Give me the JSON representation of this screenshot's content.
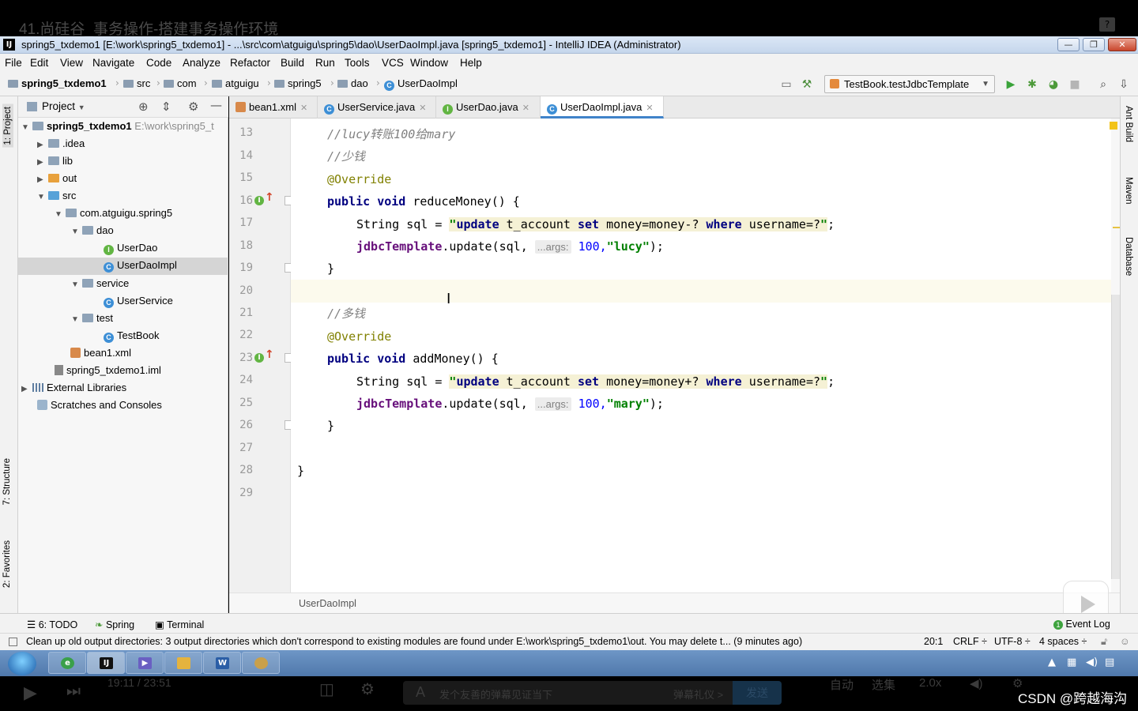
{
  "video": {
    "title": "41.尚硅谷_事务操作-搭建事务操作环境",
    "player": {
      "time": "19:11 / 23:51",
      "danmaku_placeholder": "发个友善的弹幕见证当下",
      "etiquette": "弹幕礼仪 >",
      "send": "发送",
      "auto": "自动",
      "episodes": "选集",
      "speed": "2.0x"
    },
    "watermark": "CSDN @跨越海沟"
  },
  "window": {
    "title": "spring5_txdemo1 [E:\\work\\spring5_txdemo1] - ...\\src\\com\\atguigu\\spring5\\dao\\UserDaoImpl.java [spring5_txdemo1] - IntelliJ IDEA (Administrator)",
    "min": "—",
    "max": "❐",
    "close": "✕"
  },
  "menu": [
    "File",
    "Edit",
    "View",
    "Navigate",
    "Code",
    "Analyze",
    "Refactor",
    "Build",
    "Run",
    "Tools",
    "VCS",
    "Window",
    "Help"
  ],
  "nav": {
    "crumbs": [
      "spring5_txdemo1",
      "src",
      "com",
      "atguigu",
      "spring5",
      "dao",
      "UserDaoImpl"
    ],
    "run_config": "TestBook.testJdbcTemplate"
  },
  "side_tabs": {
    "left": [
      "1: Project",
      "7: Structure",
      "2: Favorites"
    ],
    "right": [
      "Ant Build",
      "Maven",
      "Database"
    ]
  },
  "project": {
    "header": "Project",
    "tree": [
      {
        "label": "spring5_txdemo1",
        "hint": "E:\\work\\spring5_t"
      },
      {
        "label": ".idea"
      },
      {
        "label": "lib"
      },
      {
        "label": "out"
      },
      {
        "label": "src"
      },
      {
        "label": "com.atguigu.spring5"
      },
      {
        "label": "dao"
      },
      {
        "label": "UserDao"
      },
      {
        "label": "UserDaoImpl"
      },
      {
        "label": "service"
      },
      {
        "label": "UserService"
      },
      {
        "label": "test"
      },
      {
        "label": "TestBook"
      },
      {
        "label": "bean1.xml"
      },
      {
        "label": "spring5_txdemo1.iml"
      },
      {
        "label": "External Libraries"
      },
      {
        "label": "Scratches and Consoles"
      }
    ]
  },
  "tabs": [
    "bean1.xml",
    "UserService.java",
    "UserDao.java",
    "UserDaoImpl.java"
  ],
  "code": {
    "line_numbers": [
      "13",
      "14",
      "15",
      "16",
      "17",
      "18",
      "19",
      "20",
      "21",
      "22",
      "23",
      "24",
      "25",
      "26",
      "27",
      "28",
      "29"
    ],
    "comment_transfer": "//lucy转账100给mary",
    "comment_less": "//少钱",
    "override": "@Override",
    "kw_public": "public",
    "kw_void": "void",
    "method_reduce": "reduceMoney() {",
    "string_type": "String",
    "sql_var": "sql =",
    "sql_reduce_q1": "\"",
    "sql_update": "update",
    "sql_table": "t_account",
    "sql_set": "set",
    "sql_reduce_expr": "money=money-?",
    "sql_where": "where",
    "sql_username": "username=?",
    "sql_q2": "\"",
    "semi": ";",
    "jdbc": "jdbcTemplate",
    "update_call": ".update(sql,",
    "args_hint": "...args:",
    "amount": "100,",
    "name_lucy": "\"lucy\"",
    "close_call": ");",
    "brace_close": "}",
    "comment_more": "//多钱",
    "method_add": "addMoney() {",
    "sql_add_expr": "money=money+?",
    "name_mary": "\"mary\"",
    "caret": "I"
  },
  "editor_breadcrumb": "UserDaoImpl",
  "toolwindows": {
    "todo": "6: TODO",
    "spring": "Spring",
    "terminal": "Terminal",
    "event_log": "Event Log"
  },
  "status": {
    "message": "Clean up old output directories: 3 output directories which don't correspond to existing modules are found under E:\\work\\spring5_txdemo1\\out. You may delete t... (9 minutes ago)",
    "position": "20:1",
    "line_sep": "CRLF ÷",
    "encoding": "UTF-8 ÷",
    "indent": "4 spaces ÷"
  }
}
